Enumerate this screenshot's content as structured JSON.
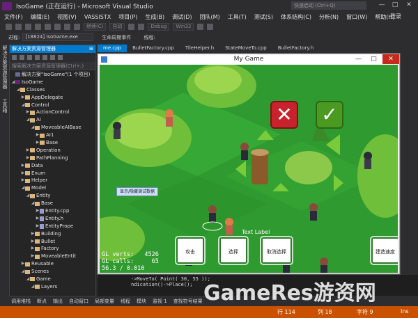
{
  "window": {
    "title": "IsoGame (正在运行) - Microsoft Visual Studio",
    "quick_launch_placeholder": "快速启动 (Ctrl+Q)",
    "minimize": "—",
    "maximize": "□",
    "close": "✕"
  },
  "menu": {
    "items": [
      "文件(F)",
      "编辑(E)",
      "视图(V)",
      "VASSISTX",
      "项目(P)",
      "生成(B)",
      "调试(D)",
      "团队(M)",
      "工具(T)",
      "测试(S)",
      "体系结构(C)",
      "分析(N)",
      "窗口(W)",
      "帮助(H)"
    ],
    "login": "登录"
  },
  "toolbar": {
    "continue_label": "继续(C)",
    "auto_label": "自动",
    "config": "Debug",
    "platform": "Win32"
  },
  "process": {
    "label": "进程:",
    "value": "[18824] IsoGame.exe",
    "lifecycle_label": "生命周期事件",
    "thread_label": "线程:"
  },
  "left_tabs": {
    "explorer": "解决方案资源管理器",
    "toolbox": "工具箱"
  },
  "solution_explorer": {
    "header": "解决方案资源管理器",
    "search_placeholder": "搜索解决方案资源管理器(Ctrl+;)",
    "nodes": [
      {
        "label": "解决方案\"IsoGame\"(1 个项目)",
        "type": "sol",
        "expanded": "",
        "indent": 0
      },
      {
        "label": "IsoGame",
        "type": "proj",
        "expanded": "◢",
        "indent": 0
      },
      {
        "label": "Classes",
        "type": "folder",
        "expanded": "◢",
        "indent": 1
      },
      {
        "label": "AppDelegate",
        "type": "folder",
        "expanded": "▶",
        "indent": 2
      },
      {
        "label": "Control",
        "type": "folder",
        "expanded": "◢",
        "indent": 2
      },
      {
        "label": "ActionControl",
        "type": "folder",
        "expanded": "▶",
        "indent": 3
      },
      {
        "label": "AI",
        "type": "folder",
        "expanded": "◢",
        "indent": 3
      },
      {
        "label": "MoveableAIBase",
        "type": "folder",
        "expanded": "◢",
        "indent": 4
      },
      {
        "label": "AI1",
        "type": "folder",
        "expanded": "▶",
        "indent": 5
      },
      {
        "label": "Base",
        "type": "folder",
        "expanded": "▶",
        "indent": 5
      },
      {
        "label": "Operation",
        "type": "folder",
        "expanded": "▶",
        "indent": 3
      },
      {
        "label": "PathPlanning",
        "type": "folder",
        "expanded": "▶",
        "indent": 3
      },
      {
        "label": "Data",
        "type": "folder",
        "expanded": "▶",
        "indent": 2
      },
      {
        "label": "Enum",
        "type": "folder",
        "expanded": "▶",
        "indent": 2
      },
      {
        "label": "Helper",
        "type": "folder",
        "expanded": "▶",
        "indent": 2
      },
      {
        "label": "Model",
        "type": "folder",
        "expanded": "◢",
        "indent": 2
      },
      {
        "label": "Entity",
        "type": "folder",
        "expanded": "◢",
        "indent": 3
      },
      {
        "label": "Base",
        "type": "folder",
        "expanded": "◢",
        "indent": 4
      },
      {
        "label": "Entity.cpp",
        "type": "file",
        "expanded": "▶",
        "indent": 5
      },
      {
        "label": "Entity.h",
        "type": "file",
        "expanded": "▶",
        "indent": 5
      },
      {
        "label": "EntityPrope",
        "type": "file",
        "expanded": "▶",
        "indent": 5
      },
      {
        "label": "Building",
        "type": "folder",
        "expanded": "▶",
        "indent": 4
      },
      {
        "label": "Bullet",
        "type": "folder",
        "expanded": "▶",
        "indent": 4
      },
      {
        "label": "Factory",
        "type": "folder",
        "expanded": "▶",
        "indent": 4
      },
      {
        "label": "MoveableEntit",
        "type": "folder",
        "expanded": "▶",
        "indent": 4
      },
      {
        "label": "Reusable",
        "type": "folder",
        "expanded": "▶",
        "indent": 2
      },
      {
        "label": "Scenes",
        "type": "folder",
        "expanded": "◢",
        "indent": 2
      },
      {
        "label": "Game",
        "type": "folder",
        "expanded": "◢",
        "indent": 3
      },
      {
        "label": "Layers",
        "type": "folder",
        "expanded": "◢",
        "indent": 4
      }
    ]
  },
  "editor_tabs": [
    "me.cpp",
    "BulletFactory.cpp",
    "TileHelper.h",
    "StateMoveTo.cpp",
    "BulletFactory.h"
  ],
  "code_lines": [
    "->MoveTo( Point( 30, 55 ));",
    "ndication()->Place();"
  ],
  "game": {
    "window_title": "My Game",
    "show_debug": "显示/隐藏调试数据",
    "text_label": "Text Label",
    "gl_verts": "GL verts:   4526",
    "gl_calls": "GL calls:     65",
    "fps": "56.3 / 0.010",
    "buttons": {
      "attack": "攻击",
      "select": "选择",
      "cancel_select": "取消选择",
      "build_speed": "建造速度"
    },
    "cancel_symbol": "✕",
    "confirm_symbol": "✓"
  },
  "bottom_tabs": [
    "调用堆栈",
    "断点",
    "输出",
    "自动窗口",
    "局部变量",
    "线程",
    "模块",
    "监视 1",
    "查找符号结果"
  ],
  "status": {
    "line": "行 114",
    "col": "列 18",
    "char": "字符 9",
    "mode": "Ins"
  },
  "watermark": "GameRes游资网",
  "colors": {
    "accent": "#007acc",
    "status_debug": "#ca5100",
    "ide_bg": "#2d2d30"
  }
}
